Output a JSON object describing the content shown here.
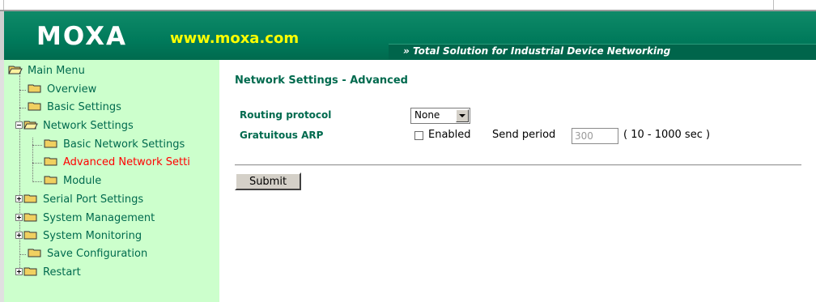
{
  "header": {
    "logo": "MOXA",
    "url": "www.moxa.com",
    "tagline": "» Total Solution for Industrial Device Networking"
  },
  "sidebar": {
    "items": [
      {
        "label": "Main Menu"
      },
      {
        "label": "Overview"
      },
      {
        "label": "Basic Settings"
      },
      {
        "label": "Network Settings"
      },
      {
        "label": "Basic Network Settings"
      },
      {
        "label": "Advanced Network Setti"
      },
      {
        "label": "Module"
      },
      {
        "label": "Serial Port Settings"
      },
      {
        "label": "System Management"
      },
      {
        "label": "System Monitoring"
      },
      {
        "label": "Save Configuration"
      },
      {
        "label": "Restart"
      }
    ]
  },
  "main": {
    "title": "Network Settings - Advanced",
    "routing": {
      "label": "Routing protocol",
      "value": "None"
    },
    "arp": {
      "label": "Gratuitous ARP",
      "enabled_label": "Enabled",
      "enabled_checked": false,
      "send_period_label": "Send period",
      "send_period_value": "300",
      "range_hint": "( 10 - 1000 sec )"
    },
    "submit_label": "Submit"
  },
  "colors": {
    "header_green": "#007a5b",
    "sidebar_bg": "#ccffcc",
    "link_green": "#006a4e",
    "active_red": "#ff0000",
    "url_yellow": "#ffff00"
  }
}
